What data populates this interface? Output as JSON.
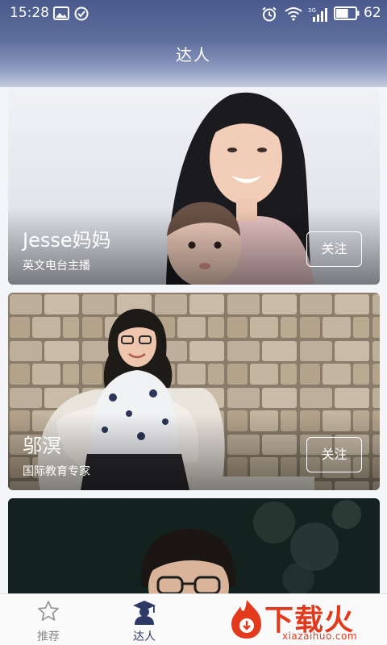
{
  "status_bar": {
    "time": "15:28",
    "network_label": "3G",
    "battery_level": "62"
  },
  "header": {
    "title": "达人"
  },
  "experts": [
    {
      "name": "Jesse妈妈",
      "description": "英文电台主播",
      "follow_label": "关注"
    },
    {
      "name": "邬溟",
      "description": "国际教育专家",
      "follow_label": "关注"
    }
  ],
  "tabs": [
    {
      "label": "推荐",
      "icon": "star-icon",
      "active": false
    },
    {
      "label": "达人",
      "icon": "graduate-icon",
      "active": true
    }
  ],
  "watermark": {
    "brand": "下载火",
    "site": "xiazaihuo.com"
  },
  "colors": {
    "header": "#4a5a8c",
    "tab_active": "#2e3a66",
    "tab_inactive": "#999999",
    "watermark": "#e33a1e"
  }
}
